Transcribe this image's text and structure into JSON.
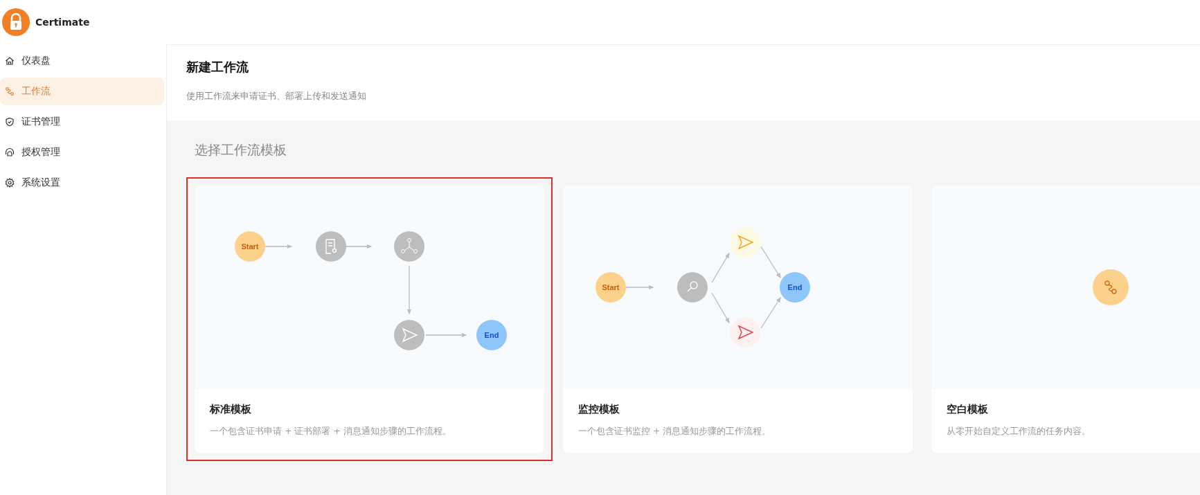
{
  "app": {
    "name": "Certimate"
  },
  "sidebar": {
    "items": [
      {
        "label": "仪表盘",
        "kind": "home",
        "selected": false
      },
      {
        "label": "工作流",
        "kind": "workflow",
        "selected": true
      },
      {
        "label": "证书管理",
        "kind": "shield",
        "selected": false
      },
      {
        "label": "授权管理",
        "kind": "access",
        "selected": false
      },
      {
        "label": "系统设置",
        "kind": "settings",
        "selected": false
      }
    ]
  },
  "header": {
    "title": "新建工作流",
    "subtitle": "使用工作流来申请证书、部署上传和发送通知"
  },
  "section_title": "选择工作流模板",
  "templates": [
    {
      "kind": "standard",
      "title": "标准模板",
      "description": "一个包含证书申请 + 证书部署 + 消息通知步骤的工作流程。",
      "selected": true,
      "start_label": "Start",
      "end_label": "End"
    },
    {
      "kind": "monitor",
      "title": "监控模板",
      "description": "一个包含证书监控 + 消息通知步骤的工作流程。",
      "selected": false,
      "start_label": "Start",
      "end_label": "End"
    },
    {
      "kind": "blank",
      "title": "空白模板",
      "description": "从零开始自定义工作流的任务内容。",
      "selected": false
    }
  ]
}
